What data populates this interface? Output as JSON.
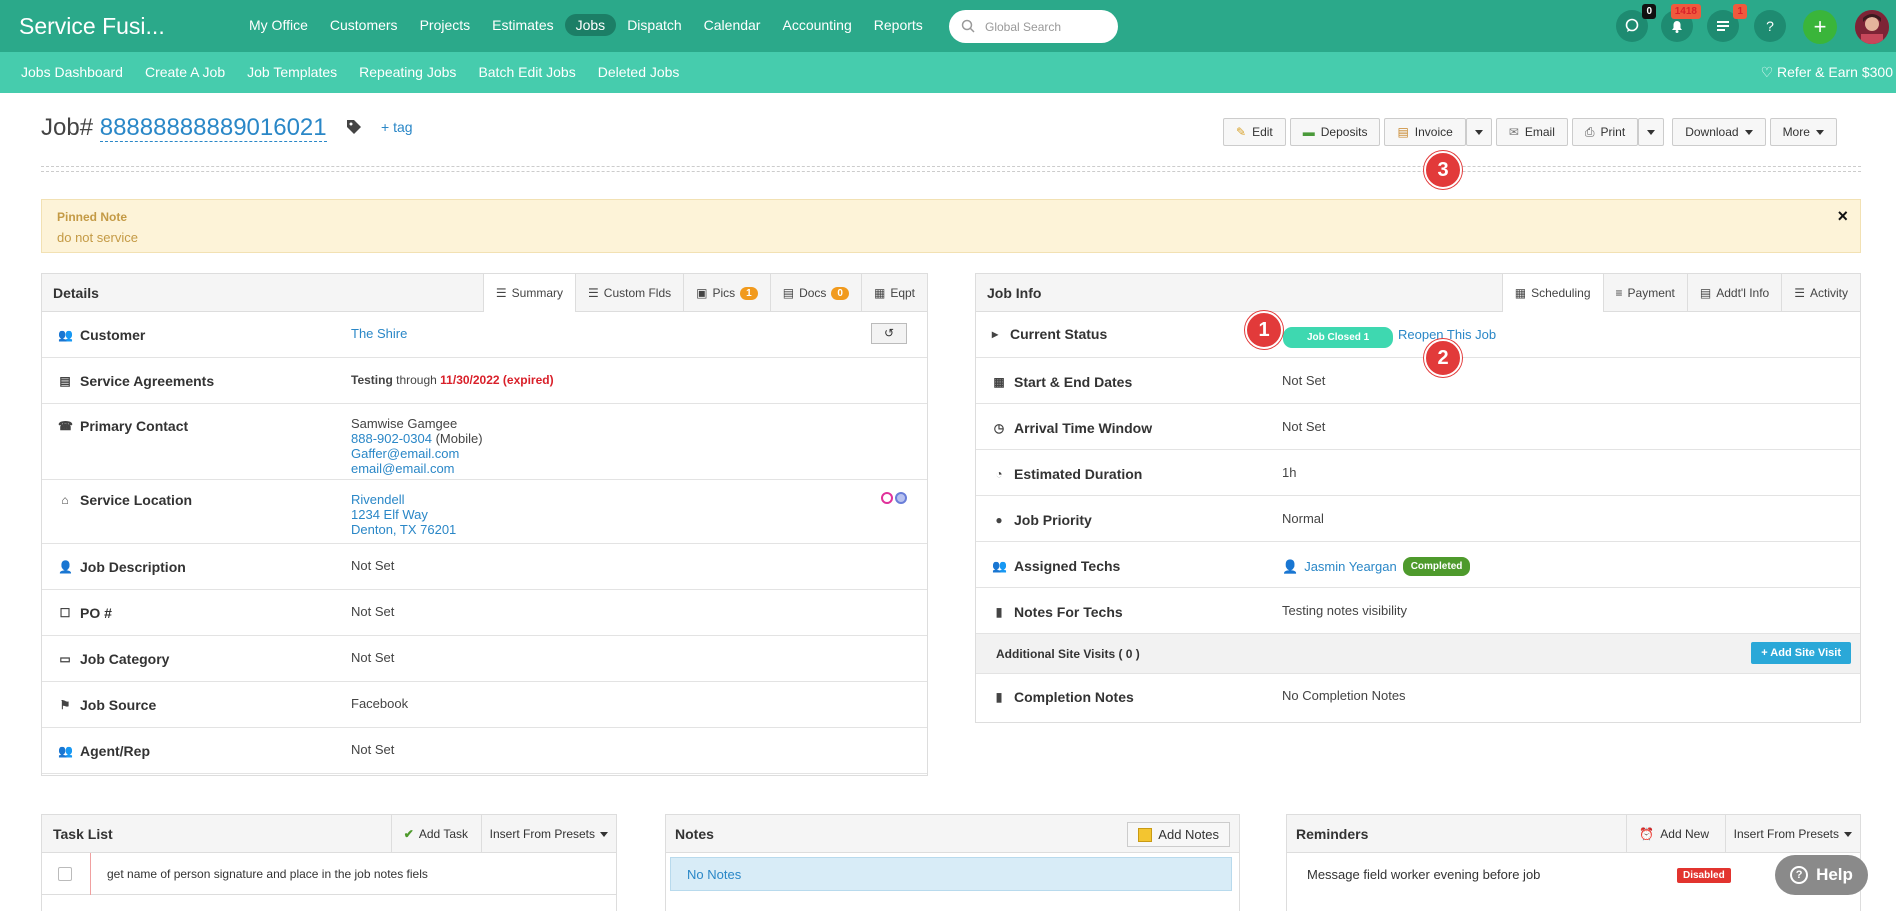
{
  "app": {
    "brand": "Service Fusi..."
  },
  "main_nav": [
    {
      "label": "My Office"
    },
    {
      "label": "Customers"
    },
    {
      "label": "Projects"
    },
    {
      "label": "Estimates"
    },
    {
      "label": "Jobs"
    },
    {
      "label": "Dispatch"
    },
    {
      "label": "Calendar"
    },
    {
      "label": "Accounting"
    },
    {
      "label": "Reports"
    }
  ],
  "search": {
    "placeholder": "Global Search"
  },
  "header_icons": {
    "chat_count": "0",
    "notif_count": "1418",
    "tasks_count": "1",
    "help_glyph": "?"
  },
  "sub_nav": [
    {
      "label": "Jobs Dashboard"
    },
    {
      "label": "Create A Job"
    },
    {
      "label": "Job Templates"
    },
    {
      "label": "Repeating Jobs"
    },
    {
      "label": "Batch Edit Jobs"
    },
    {
      "label": "Deleted Jobs"
    }
  ],
  "refer": "Refer & Earn $300",
  "job": {
    "prefix": "Job#",
    "number": "88888888889016021",
    "add_tag": "+ tag"
  },
  "toolbar": {
    "edit": "Edit",
    "deposits": "Deposits",
    "invoice": "Invoice",
    "email": "Email",
    "print": "Print",
    "download": "Download",
    "more": "More"
  },
  "steps": {
    "one": "1",
    "two": "2",
    "three": "3"
  },
  "pinned": {
    "title": "Pinned Note",
    "text": "do not service",
    "close": "×"
  },
  "details": {
    "title": "Details",
    "tabs": {
      "summary": "Summary",
      "custom": "Custom Flds",
      "pics": "Pics",
      "pics_count": "1",
      "docs": "Docs",
      "docs_count": "0",
      "eqpt": "Eqpt"
    },
    "customer_label": "Customer",
    "customer_value": "The Shire",
    "sa_label": "Service Agreements",
    "sa_name": "Testing",
    "sa_through": "through",
    "sa_date": "11/30/2022 (expired)",
    "pc_label": "Primary Contact",
    "pc_name": "Samwise Gamgee",
    "pc_phone": "888-902-0304",
    "pc_phone_type": "(Mobile)",
    "pc_email1": "Gaffer@email.com",
    "pc_email2": "email@email.com",
    "loc_label": "Service Location",
    "loc_name": "Rivendell",
    "loc_street": "1234 Elf Way",
    "loc_city": "Denton, TX 76201",
    "desc_label": "Job Description",
    "desc_value": "Not Set",
    "po_label": "PO #",
    "po_value": "Not Set",
    "cat_label": "Job Category",
    "cat_value": "Not Set",
    "src_label": "Job Source",
    "src_value": "Facebook",
    "agent_label": "Agent/Rep",
    "agent_value": "Not Set"
  },
  "jobinfo": {
    "title": "Job Info",
    "tabs": {
      "scheduling": "Scheduling",
      "payment": "Payment",
      "addl": "Addt'l Info",
      "activity": "Activity"
    },
    "status_label": "Current Status",
    "status_value": "Job Closed 1",
    "reopen": "Reopen This Job",
    "dates_label": "Start & End Dates",
    "dates_value": "Not Set",
    "arrival_label": "Arrival Time Window",
    "arrival_value": "Not Set",
    "duration_label": "Estimated Duration",
    "duration_value": "1h",
    "priority_label": "Job Priority",
    "priority_value": "Normal",
    "techs_label": "Assigned Techs",
    "tech_name": "Jasmin Yeargan",
    "tech_status": "Completed",
    "notes_label": "Notes For Techs",
    "notes_value": "Testing notes visibility",
    "visits_label": "Additional Site Visits ( 0 )",
    "add_visit": "+ Add Site Visit",
    "completion_label": "Completion Notes",
    "completion_value": "No Completion Notes"
  },
  "tasks": {
    "title": "Task List",
    "add": "Add Task",
    "presets": "Insert From Presets",
    "item1": "get name of person signature and place in the job notes fiels"
  },
  "notes": {
    "title": "Notes",
    "add": "Add Notes",
    "empty": "No Notes"
  },
  "reminders": {
    "title": "Reminders",
    "add": "Add New",
    "presets": "Insert From Presets",
    "item1": "Message field worker evening before job",
    "item1_status": "Disabled"
  },
  "help": {
    "label": "Help"
  },
  "colors": {
    "topbar": "#2ba98a",
    "subbar": "#46ccad",
    "link": "#2a87c7",
    "step": "#e23a3a"
  }
}
